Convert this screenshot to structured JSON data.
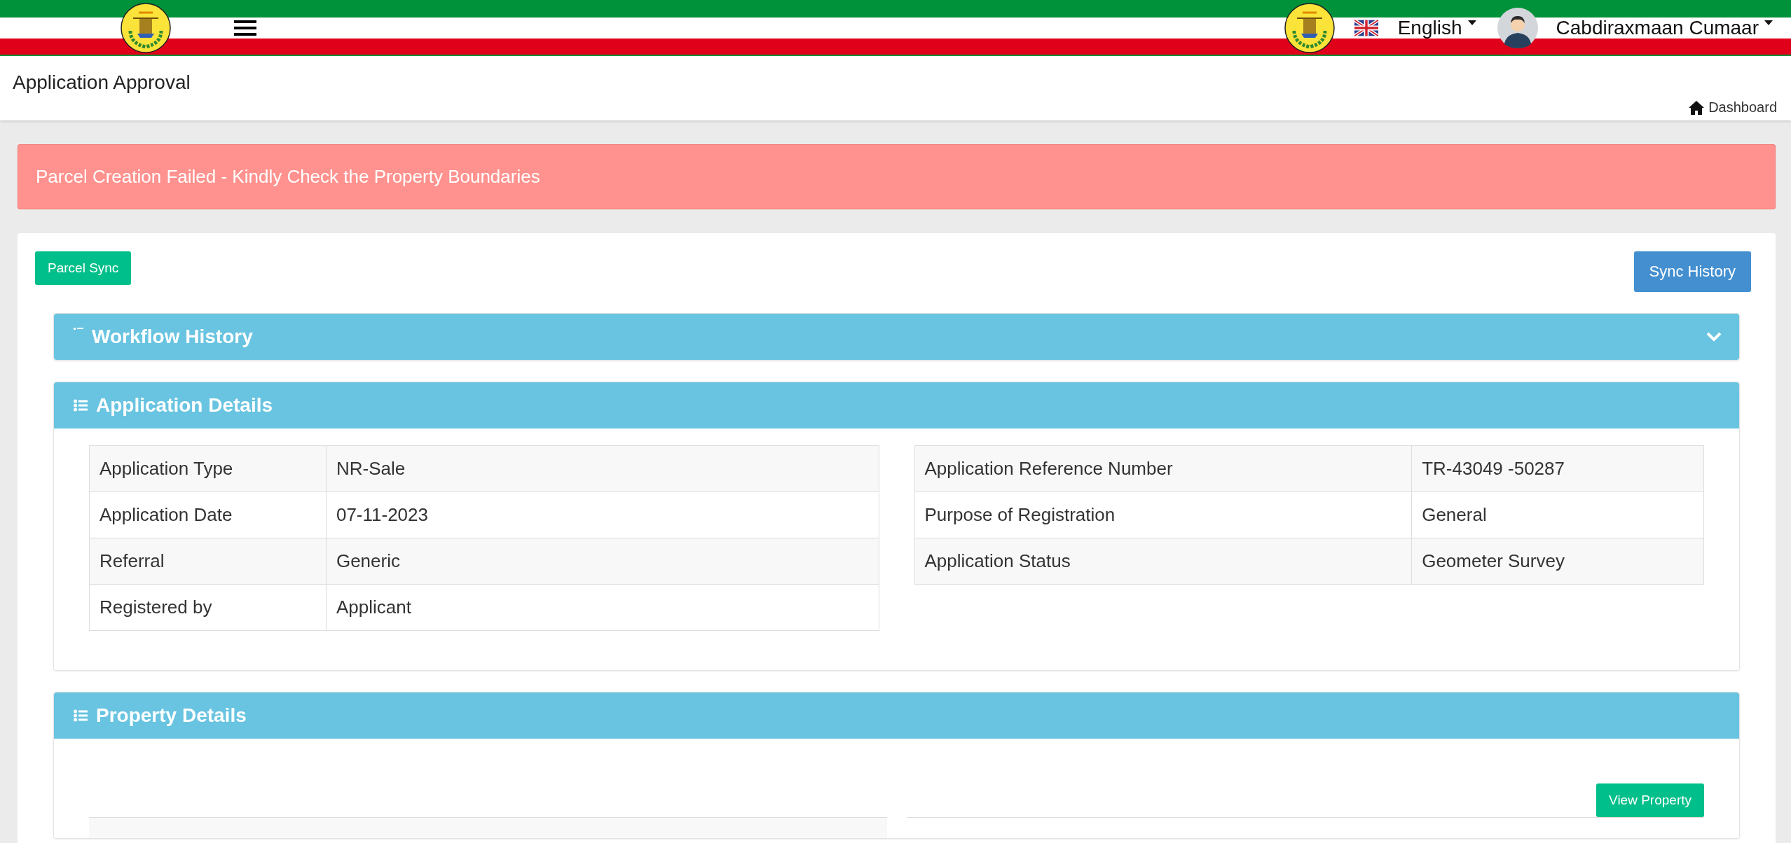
{
  "topbar": {
    "language": "English",
    "user": "Cabdiraxmaan Cumaar"
  },
  "header": {
    "title": "Application Approval",
    "breadcrumb": "Dashboard"
  },
  "alert": {
    "message": "Parcel Creation Failed - Kindly Check the Property Boundaries"
  },
  "actions": {
    "left_button": "Parcel Sync",
    "right_button": "Sync History"
  },
  "workflow_history": {
    "title": "Workflow History",
    "expanded": false
  },
  "application_details": {
    "title": "Application Details",
    "left_table": [
      {
        "label": "Application Type",
        "value": "NR-Sale"
      },
      {
        "label": "Application Date",
        "value": "07-11-2023"
      },
      {
        "label": "Referral",
        "value": "Generic"
      },
      {
        "label": "Registered by",
        "value": "Applicant"
      }
    ],
    "right_table": [
      {
        "label": "Application Reference Number",
        "value": "TR-43049 -50287"
      },
      {
        "label": "Purpose of Registration",
        "value": "General"
      },
      {
        "label": "Application Status",
        "value": "Geometer Survey"
      }
    ]
  },
  "property_details": {
    "title": "Property Details",
    "button": "View Property"
  }
}
